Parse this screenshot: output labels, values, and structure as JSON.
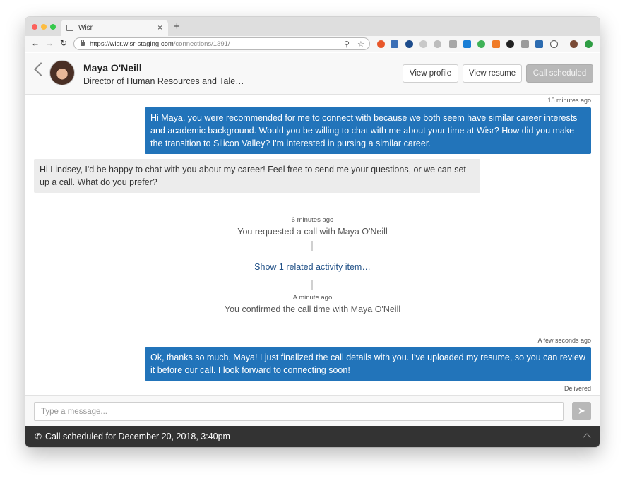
{
  "browser": {
    "tab_title": "Wisr",
    "tab_close": "×",
    "new_tab": "+",
    "url_host": "https://wisr.wisr-staging.com",
    "url_path": "/connections/1391/",
    "nav": {
      "back": "←",
      "forward": "→",
      "reload": "↻"
    },
    "traffic_colors": [
      "#fc605b",
      "#fdbc40",
      "#34c84a"
    ]
  },
  "header": {
    "name": "Maya O'Neill",
    "title": "Director of Human Resources and Tale…",
    "buttons": {
      "view_profile": "View profile",
      "view_resume": "View resume",
      "call_scheduled": "Call scheduled"
    }
  },
  "messages": {
    "m1_time": "15 minutes ago",
    "m1_text": "Hi Maya, you were recommended for me to connect with because we both seem have similar career interests and academic background. Would you be willing to chat with me about your time at Wisr? How did you make the transition to Silicon Valley? I'm interested in pursing a similar career.",
    "m2_text": "Hi Lindsey, I'd be happy to chat with you about my career! Feel free to send me your questions, or we can set up a call. What do you prefer?",
    "e1_time": "6 minutes ago",
    "e1_text": "You requested a call with Maya O'Neill",
    "related_link": "Show 1 related activity item…",
    "e2_time": "A minute ago",
    "e2_text": "You confirmed the call time with Maya O'Neill",
    "m3_time": "A few seconds ago",
    "m3_text": "Ok, thanks so much, Maya! I just finalized the call details with you. I've uploaded my resume, so you can review it before our call. I look forward to connecting soon!",
    "m3_status": "Delivered"
  },
  "composer": {
    "placeholder": "Type a message..."
  },
  "footer": {
    "text": "Call scheduled for December 20, 2018, 3:40pm"
  },
  "colors": {
    "outgoing_bubble": "#2274ba",
    "incoming_bubble": "#ececec",
    "footer_bg": "#333333"
  }
}
